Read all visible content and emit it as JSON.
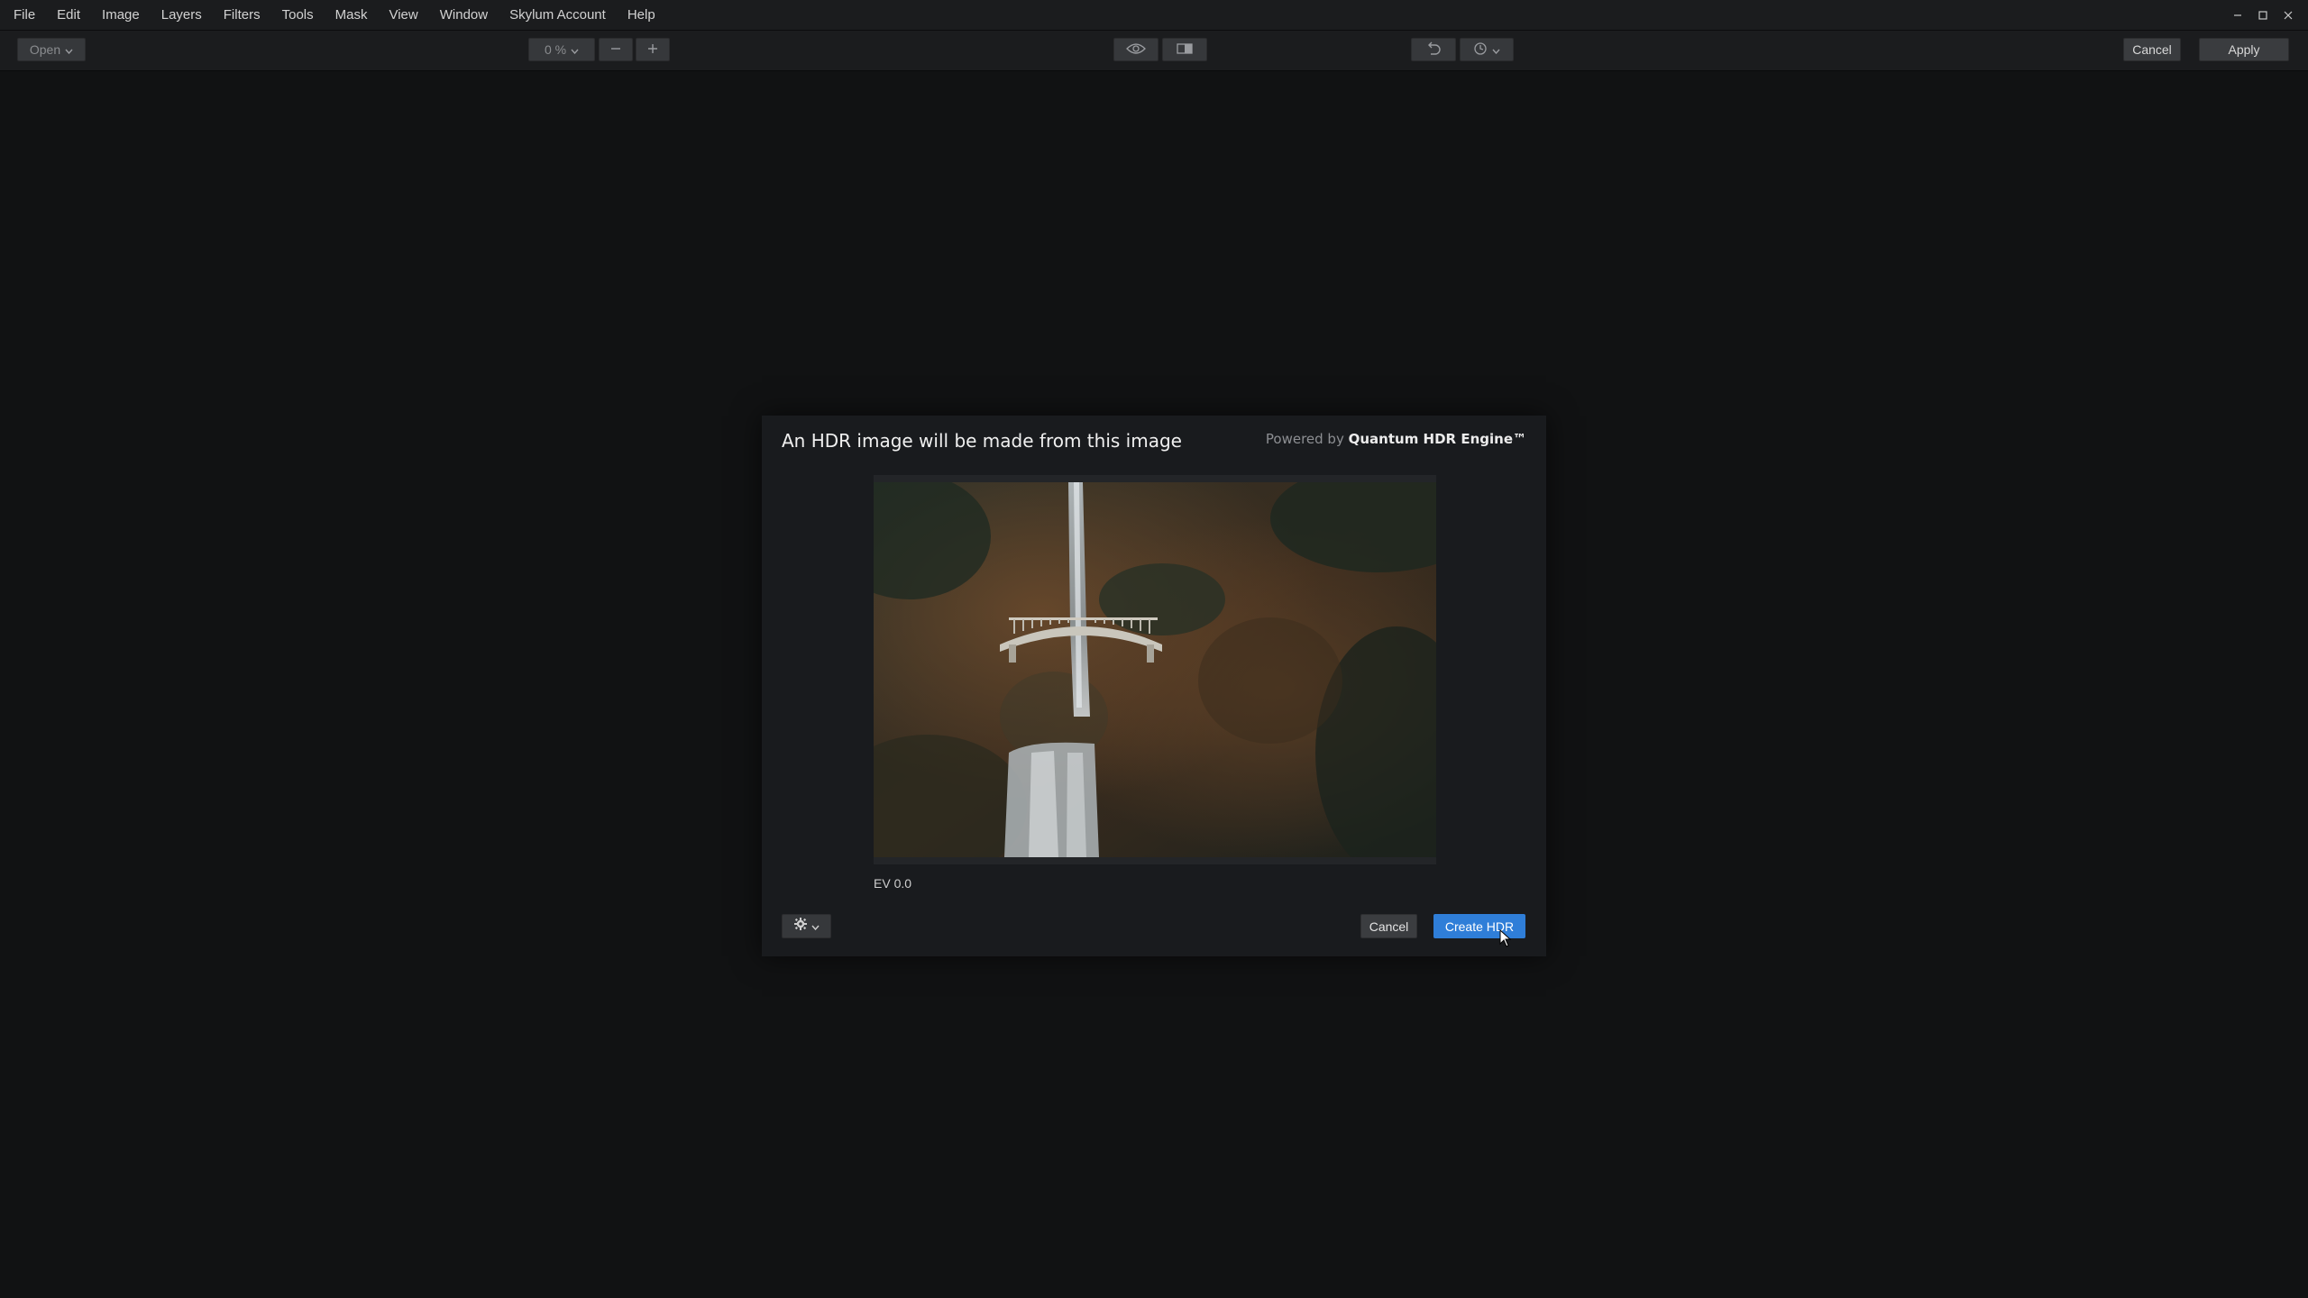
{
  "menubar": {
    "items": [
      "File",
      "Edit",
      "Image",
      "Layers",
      "Filters",
      "Tools",
      "Mask",
      "View",
      "Window",
      "Skylum Account",
      "Help"
    ]
  },
  "toolbar": {
    "open_label": "Open",
    "zoom_value": "0 %",
    "cancel_label": "Cancel",
    "apply_label": "Apply"
  },
  "dialog": {
    "title": "An HDR image will be made from this image",
    "powered_prefix": "Powered by",
    "powered_brand": "Quantum HDR Engine™",
    "ev_label": "EV 0.0",
    "cancel_label": "Cancel",
    "create_label": "Create HDR"
  },
  "icons": {
    "eye": "eye-icon",
    "compare": "compare-icon",
    "undo": "undo-icon",
    "history": "history-icon",
    "settings": "gear-icon",
    "zoom_out": "minus-icon",
    "zoom_in": "plus-icon",
    "minimize": "minimize-icon",
    "maximize": "maximize-icon",
    "close": "close-icon"
  },
  "colors": {
    "accent": "#2f7ed8",
    "background": "#111213",
    "panel": "#1b1c1e"
  }
}
